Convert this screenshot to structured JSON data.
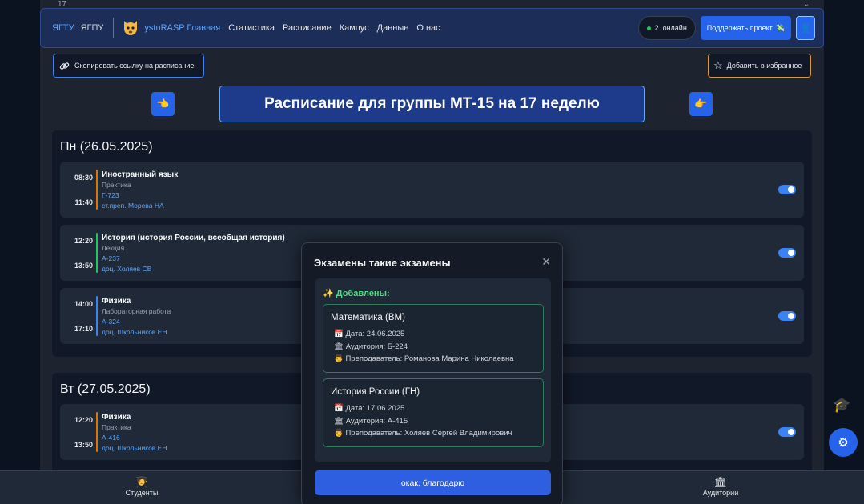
{
  "topstrip": {
    "week": "17",
    "chevron_icon": "chevron-down"
  },
  "header": {
    "links": [
      "ЯГТУ",
      "ЯГПУ"
    ],
    "logo_icon": "cat-logo",
    "brand": "ystuRASP Главная",
    "nav": [
      "Статистика",
      "Расписание",
      "Кампус",
      "Данные",
      "О нас"
    ],
    "online_count": "2",
    "online_label": "онлайн",
    "support_label": "Поддержать проект",
    "support_icon": "money-with-wings-icon",
    "user_icon": "user-icon"
  },
  "actions": {
    "copy_link": "Скопировать ссылку на расписание",
    "favorite": "Добавить в избранное"
  },
  "title": "Расписание для группы МТ-15 на 17 неделю",
  "days": [
    {
      "title": "Пн (26.05.2025)",
      "lessons": [
        {
          "start": "08:30",
          "end": "11:40",
          "name": "Иностранный язык",
          "type": "Практика",
          "room": "Г-723",
          "teacher": "ст.преп. Морева НА",
          "bar_color": "#d97706"
        },
        {
          "start": "12:20",
          "end": "13:50",
          "name": "История (история России, всеобщая история)",
          "type": "Лекция",
          "room": "А-237",
          "teacher": "доц. Холяев СВ",
          "bar_color": "#22c55e"
        },
        {
          "start": "14:00",
          "end": "17:10",
          "name": "Физика",
          "type": "Лабораторная работа",
          "room": "А-324",
          "teacher": "доц. Школьников ЕН",
          "bar_color": "#3b82f6"
        }
      ]
    },
    {
      "title": "Вт (27.05.2025)",
      "lessons": [
        {
          "start": "12:20",
          "end": "13:50",
          "name": "Физика",
          "type": "Практика",
          "room": "А-416",
          "teacher": "доц. Школьников ЕН",
          "bar_color": "#d97706"
        }
      ]
    }
  ],
  "bottom_nav": {
    "students": "Студенты",
    "rooms": "Аудитории"
  },
  "modal": {
    "title": "Экзамены такие экзамены",
    "added": "✨ Добавлены:",
    "exams": [
      {
        "name": "Математика (ВМ)",
        "date": "📅 Дата: 24.06.2025",
        "room": "🏛 Аудитория: Б-224",
        "teacher": "👨 Преподаватель: Романова Марина Николаевна"
      },
      {
        "name": "История России (ГН)",
        "date": "📅 Дата: 17.06.2025",
        "room": "🏛 Аудитория: А-415",
        "teacher": "👨 Преподаватель: Холяев Сергей Владимирович"
      }
    ],
    "ok": "окак, благодарю"
  },
  "colors": {
    "accent": "#2563eb",
    "brand": "#60a5fa",
    "success": "#22c55e",
    "favorite_border": "#d99a2b"
  }
}
